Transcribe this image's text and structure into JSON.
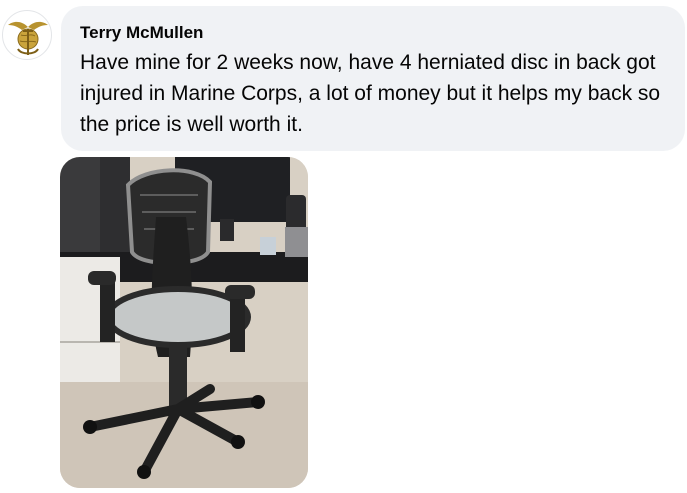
{
  "comment": {
    "author": "Terry McMullen",
    "text": "Have mine for 2 weeks now, have 4 herniated disc in back got injured in Marine Corps, a lot of money but it helps my back so the price is well worth it."
  },
  "icons": {
    "avatar": "eagle-globe-anchor-emblem"
  },
  "colors": {
    "bubble": "#f0f2f5",
    "text": "#050505"
  }
}
